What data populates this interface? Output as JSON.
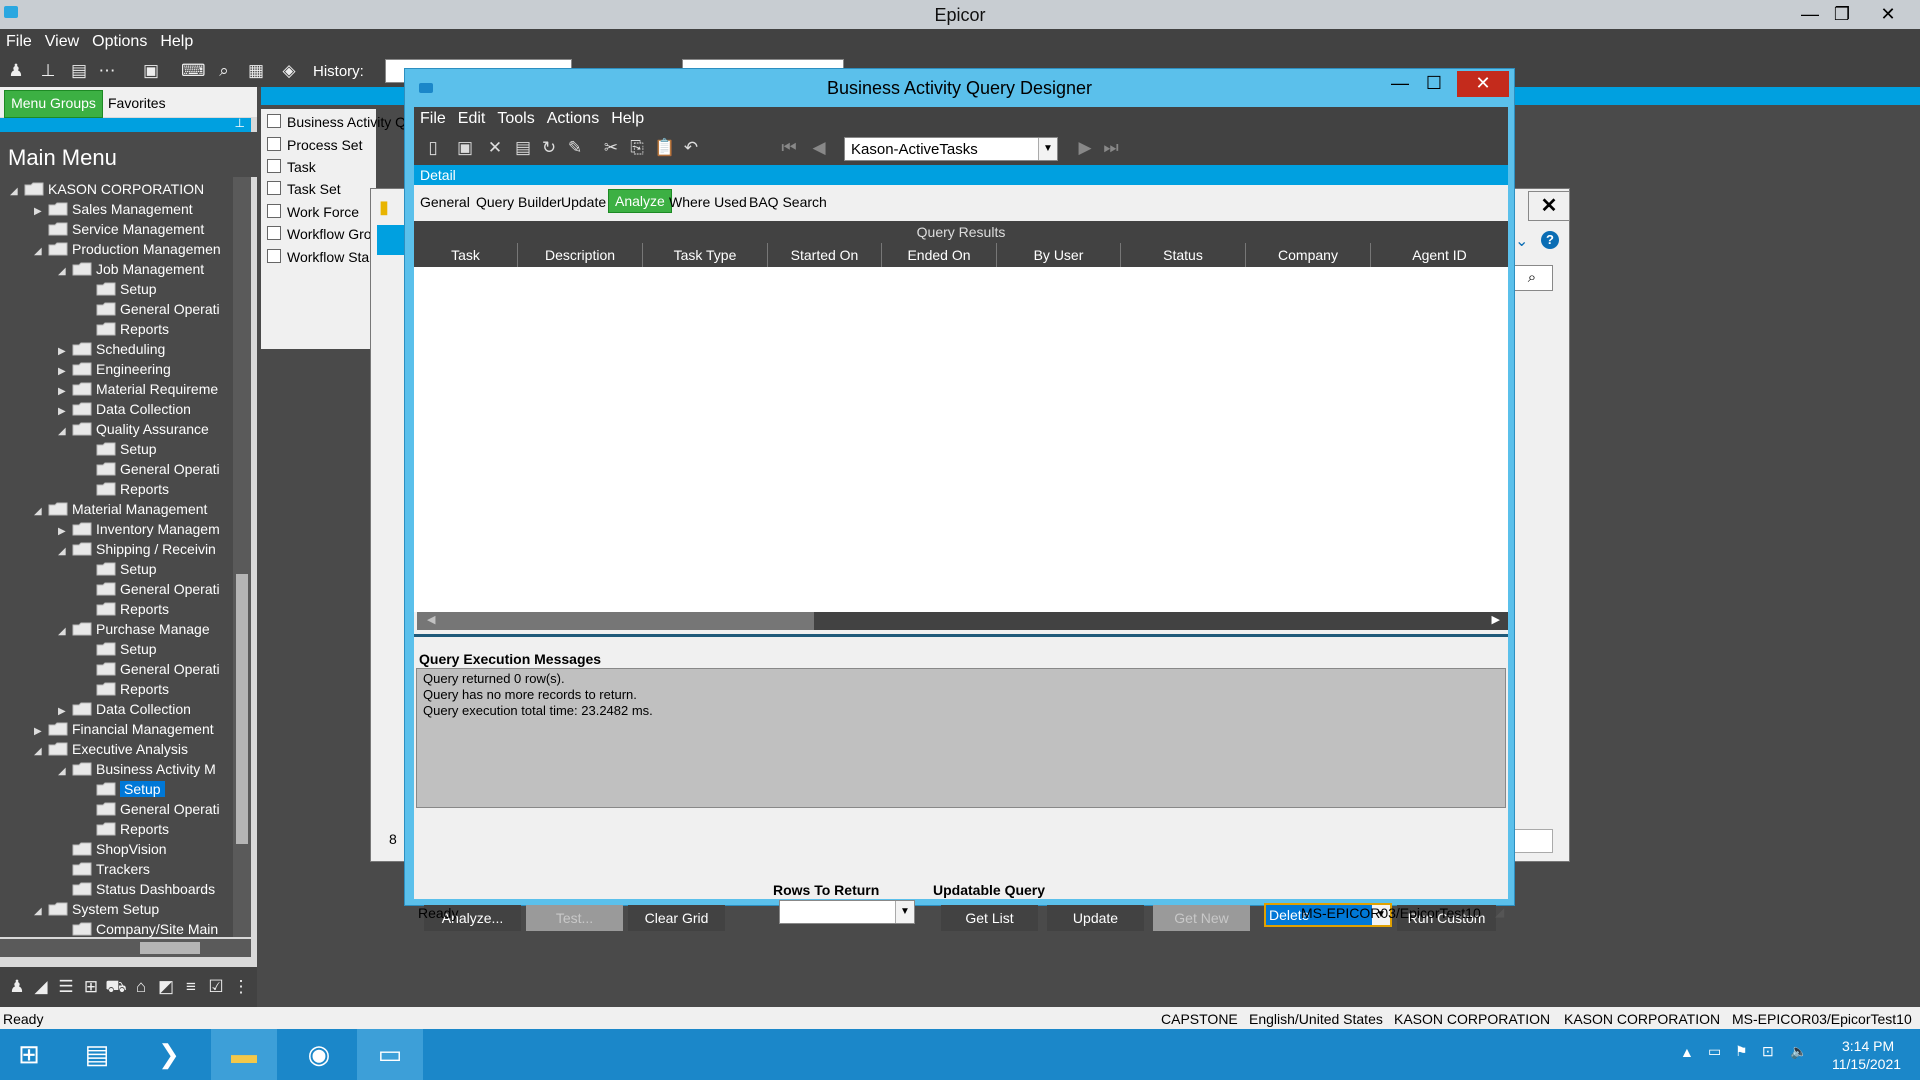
{
  "app": {
    "title": "Epicor",
    "menu": [
      "File",
      "View",
      "Options",
      "Help"
    ],
    "history_label": "History:"
  },
  "left_panel": {
    "tab_menu_groups": "Menu Groups",
    "tab_favorites": "Favorites",
    "main_menu_title": "Main Menu",
    "tree": [
      {
        "label": "KASON CORPORATION",
        "level": 0,
        "arrow": "◢"
      },
      {
        "label": "Sales Management",
        "level": 1,
        "arrow": "▶"
      },
      {
        "label": "Service Management",
        "level": 1,
        "arrow": ""
      },
      {
        "label": "Production Managemen",
        "level": 1,
        "arrow": "◢"
      },
      {
        "label": "Job Management",
        "level": 2,
        "arrow": "◢"
      },
      {
        "label": "Setup",
        "level": 3,
        "arrow": ""
      },
      {
        "label": "General Operati",
        "level": 3,
        "arrow": ""
      },
      {
        "label": "Reports",
        "level": 3,
        "arrow": ""
      },
      {
        "label": "Scheduling",
        "level": 2,
        "arrow": "▶"
      },
      {
        "label": "Engineering",
        "level": 2,
        "arrow": "▶"
      },
      {
        "label": "Material Requireme",
        "level": 2,
        "arrow": "▶"
      },
      {
        "label": "Data Collection",
        "level": 2,
        "arrow": "▶"
      },
      {
        "label": "Quality Assurance",
        "level": 2,
        "arrow": "◢"
      },
      {
        "label": "Setup",
        "level": 3,
        "arrow": ""
      },
      {
        "label": "General Operati",
        "level": 3,
        "arrow": ""
      },
      {
        "label": "Reports",
        "level": 3,
        "arrow": ""
      },
      {
        "label": "Material Management",
        "level": 1,
        "arrow": "◢"
      },
      {
        "label": "Inventory Managem",
        "level": 2,
        "arrow": "▶"
      },
      {
        "label": "Shipping / Receivin",
        "level": 2,
        "arrow": "◢"
      },
      {
        "label": "Setup",
        "level": 3,
        "arrow": ""
      },
      {
        "label": "General Operati",
        "level": 3,
        "arrow": ""
      },
      {
        "label": "Reports",
        "level": 3,
        "arrow": ""
      },
      {
        "label": "Purchase Manage",
        "level": 2,
        "arrow": "◢"
      },
      {
        "label": "Setup",
        "level": 3,
        "arrow": ""
      },
      {
        "label": "General Operati",
        "level": 3,
        "arrow": ""
      },
      {
        "label": "Reports",
        "level": 3,
        "arrow": ""
      },
      {
        "label": "Data Collection",
        "level": 2,
        "arrow": "▶"
      },
      {
        "label": "Financial Management",
        "level": 1,
        "arrow": "▶"
      },
      {
        "label": "Executive Analysis",
        "level": 1,
        "arrow": "◢"
      },
      {
        "label": "Business Activity M",
        "level": 2,
        "arrow": "◢"
      },
      {
        "label": "Setup",
        "level": 3,
        "arrow": "",
        "selected": true
      },
      {
        "label": "General Operati",
        "level": 3,
        "arrow": ""
      },
      {
        "label": "Reports",
        "level": 3,
        "arrow": ""
      },
      {
        "label": "ShopVision",
        "level": 2,
        "arrow": ""
      },
      {
        "label": "Trackers",
        "level": 2,
        "arrow": ""
      },
      {
        "label": "Status Dashboards",
        "level": 2,
        "arrow": ""
      },
      {
        "label": "System Setup",
        "level": 1,
        "arrow": "◢"
      },
      {
        "label": "Company/Site Main",
        "level": 2,
        "arrow": ""
      }
    ]
  },
  "list_pane": [
    "Business Activity Q",
    "Process Set",
    "Task",
    "Task Set",
    "Work Force",
    "Workflow Gro",
    "Workflow Sta"
  ],
  "dialog": {
    "title": "Business Activity Query Designer",
    "menu": [
      "File",
      "Edit",
      "Tools",
      "Actions",
      "Help"
    ],
    "query_id": "Kason-ActiveTasks",
    "detail_label": "Detail",
    "tabs": [
      "General",
      "Query Builder",
      "Update",
      "Analyze",
      "Where Used",
      "BAQ Search"
    ],
    "active_tab": "Analyze",
    "query_results_label": "Query Results",
    "columns": [
      "Task",
      "Description",
      "Task Type",
      "Started On",
      "Ended On",
      "By User",
      "Status",
      "Company",
      "Agent ID"
    ],
    "messages_title": "Query Execution Messages",
    "messages": [
      "Query returned 0 row(s).",
      "Query has no more records to return.",
      "Query execution total time: 23.2482 ms."
    ],
    "buttons": {
      "analyze": "Analyze...",
      "test": "Test...",
      "clear_grid": "Clear Grid",
      "get_list": "Get List",
      "update": "Update",
      "get_new": "Get New",
      "run_custom": "Run Custom"
    },
    "rows_to_return_label": "Rows To Return",
    "updatable_query_label": "Updatable Query",
    "action_select": "Delete",
    "status_ready": "Ready",
    "status_server": "MS-EPICOR03/EpicorTest10"
  },
  "bg_window_fragment": "8",
  "status_bar": {
    "ready": "Ready",
    "user": "CAPSTONE",
    "locale": "English/United States",
    "company1": "KASON CORPORATION",
    "company2": "KASON CORPORATION",
    "server": "MS-EPICOR03/EpicorTest10"
  },
  "taskbar": {
    "time": "3:14 PM",
    "date": "11/15/2021"
  },
  "colors": {
    "accent_green": "#3cb043",
    "accent_blue": "#00a0e0",
    "dark_bg": "#424242"
  }
}
